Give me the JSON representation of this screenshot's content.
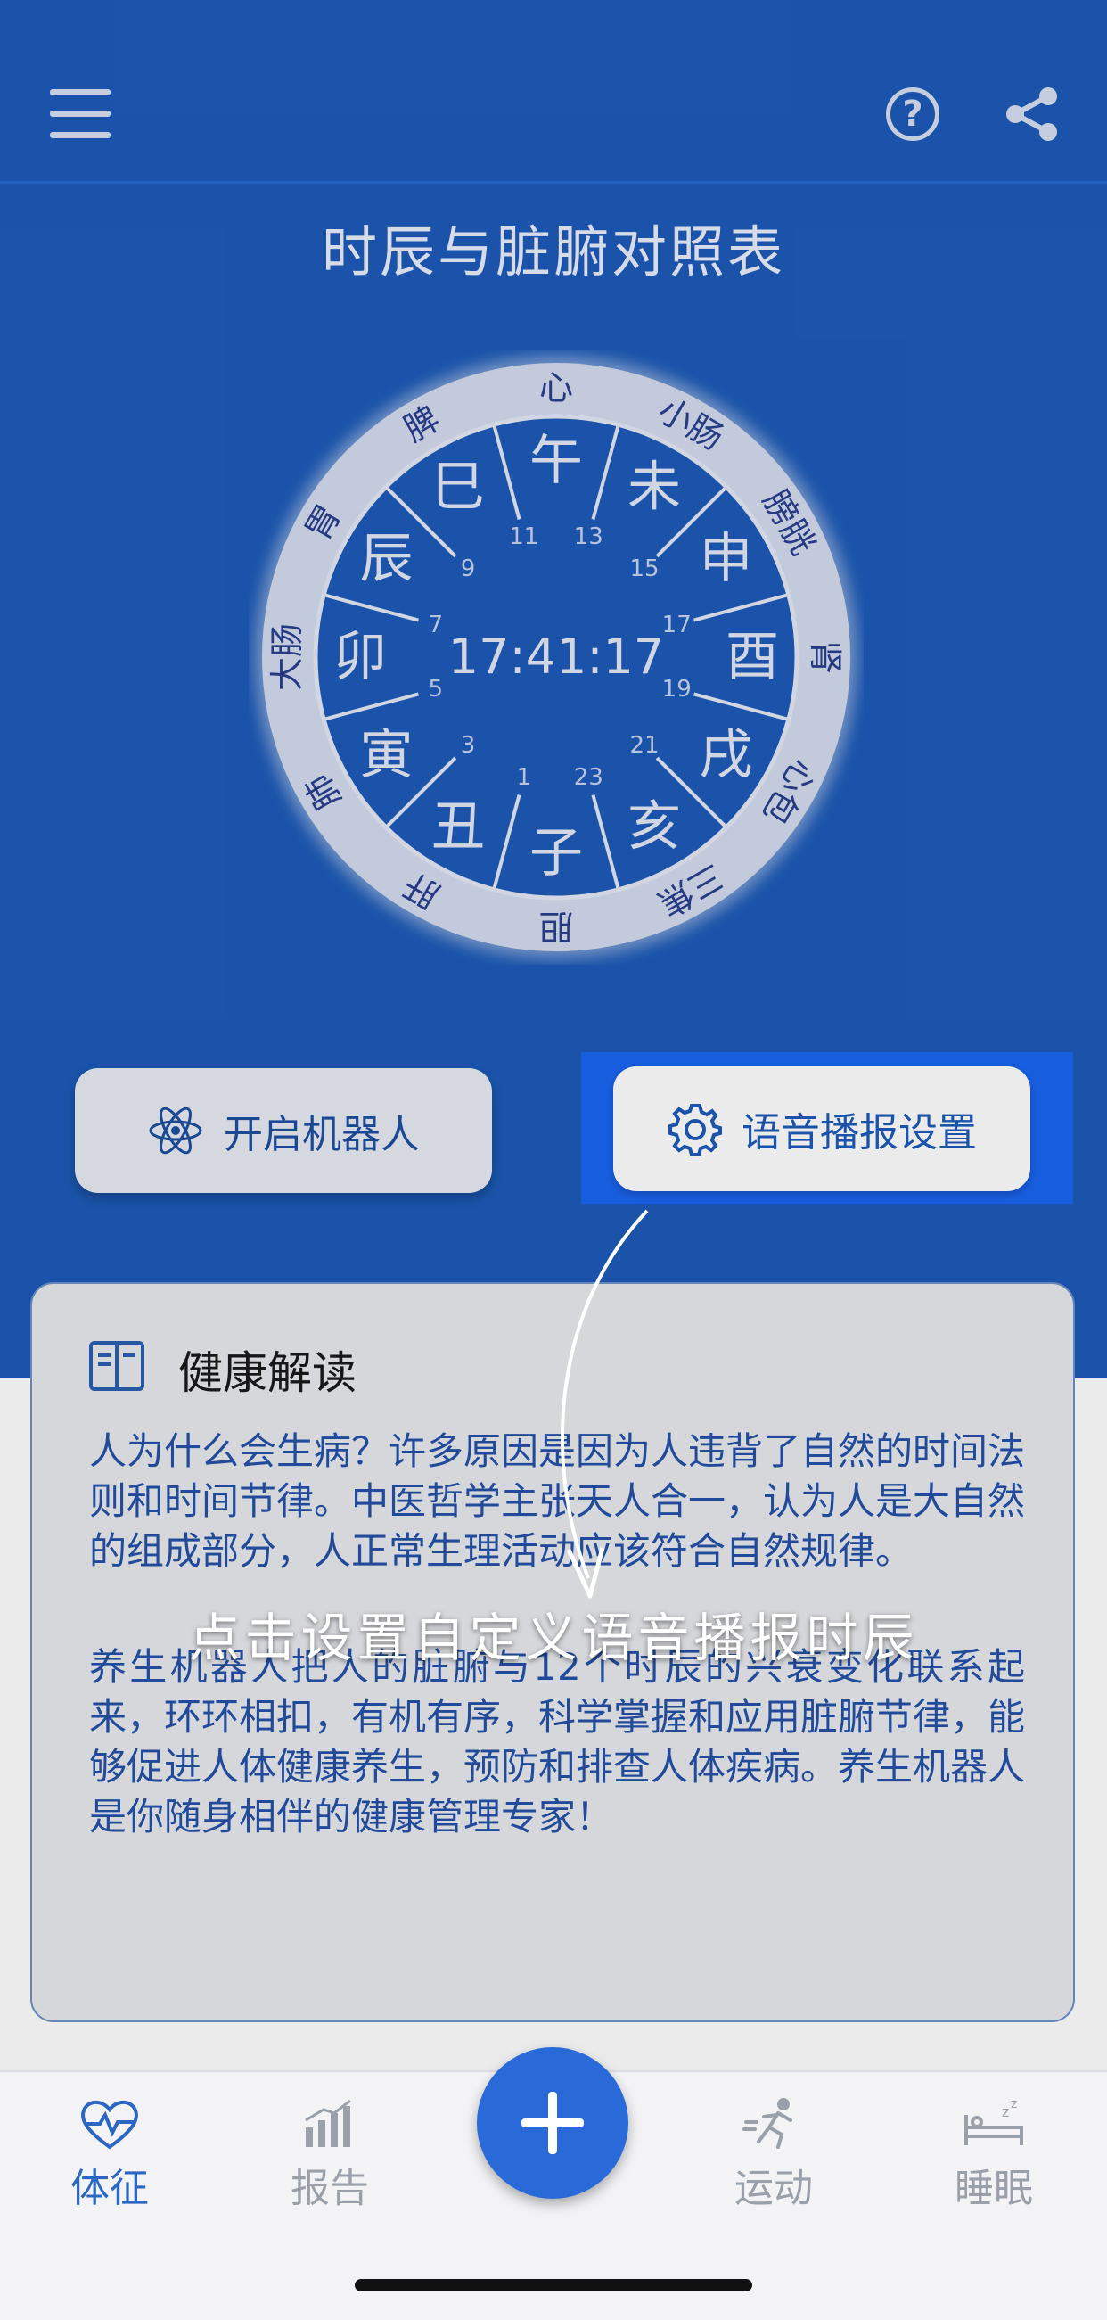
{
  "header": {
    "title": "时辰与脏腑对照表",
    "menu_icon": "hamburger-icon",
    "help_icon": "question-circle-icon",
    "help_glyph": "?",
    "share_icon": "share-icon"
  },
  "clock": {
    "time": "17:41:17",
    "branches": [
      "午",
      "未",
      "申",
      "酉",
      "戌",
      "亥",
      "子",
      "丑",
      "寅",
      "卯",
      "辰",
      "巳"
    ],
    "hours": [
      "13",
      "15",
      "17",
      "19",
      "21",
      "23",
      "1",
      "3",
      "5",
      "7",
      "9",
      "11"
    ],
    "organs": [
      "心",
      "小肠",
      "膀胱",
      "肾",
      "心包",
      "三焦",
      "胆",
      "肝",
      "肺",
      "大肠",
      "胃",
      "脾"
    ]
  },
  "buttons": {
    "robot_label": "开启机器人",
    "voice_label": "语音播报设置"
  },
  "card": {
    "title": "健康解读",
    "paragraph1": "人为什么会生病？许多原因是因为人违背了自然的时间法则和时间节律。中医哲学主张天人合一，认为人是大自然的组成部分，人正常生理活动应该符合自然规律。",
    "paragraph2": "养生机器人把人的脏腑与12个时辰的兴衰变化联系起来，环环相扣，有机有序，科学掌握和应用脏腑节律，能够促进人体健康养生，预防和排查人体疾病。养生机器人是你随身相伴的健康管理专家！"
  },
  "overlay": {
    "hint": "点击设置自定义语音播报时辰"
  },
  "nav": {
    "items": [
      {
        "label": "体征",
        "icon": "heart-pulse-icon"
      },
      {
        "label": "报告",
        "icon": "bar-chart-icon"
      },
      {
        "label": "运动",
        "icon": "running-icon"
      },
      {
        "label": "睡眠",
        "icon": "sleep-bed-icon"
      }
    ],
    "add_icon": "plus-icon"
  },
  "colors": {
    "primary": "#1d5bb8",
    "highlight": "#1a66f2",
    "active_nav": "#2a66c2",
    "inactive_nav": "#9aa0aa"
  }
}
